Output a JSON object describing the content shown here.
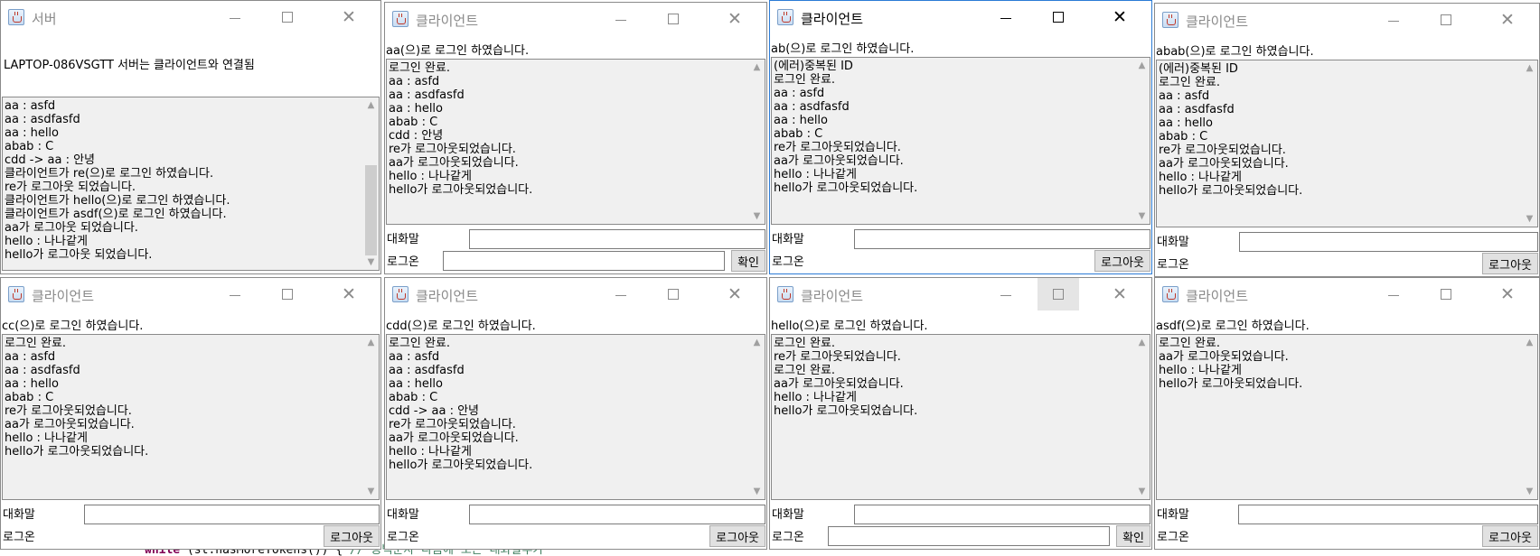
{
  "labels": {
    "chat": "대화말",
    "login": "로그온",
    "confirm": "확인",
    "logout": "로그아웃"
  },
  "server": {
    "title": "서버",
    "status": "LAPTOP-086VSGTT 서버는 클라이언트와 연결됨",
    "lines": [
      "aa : asfd",
      "aa : asdfasfd",
      "aa : hello",
      "abab : C",
      "cdd -> aa : 안녕",
      "클라이언트가 re(으)로 로그인 하였습니다.",
      "re가 로그아웃 되었습니다.",
      "클라이언트가 hello(으)로 로그인 하였습니다.",
      "클라이언트가 asdf(으)로 로그인 하였습니다.",
      "aa가 로그아웃 되었습니다.",
      "hello : 나나같게",
      "hello가 로그아웃 되었습니다."
    ]
  },
  "clients": [
    {
      "title": "클라이언트",
      "status": "aa(으)로 로그인 하였습니다.",
      "action": "확인",
      "lines": [
        "로그인 완료.",
        "aa : asfd",
        "aa : asdfasfd",
        "aa : hello",
        "abab : C",
        "cdd : 안녕",
        "re가 로그아웃되었습니다.",
        "aa가 로그아웃되었습니다.",
        "hello : 나나같게",
        "hello가 로그아웃되었습니다."
      ]
    },
    {
      "title": "클라이언트",
      "status": "ab(으)로 로그인 하였습니다.",
      "action": "로그아웃",
      "lines": [
        "(에러)중복된 ID",
        "로그인 완료.",
        "aa : asfd",
        "aa : asdfasfd",
        "aa : hello",
        "abab : C",
        "re가 로그아웃되었습니다.",
        "aa가 로그아웃되었습니다.",
        "hello : 나나같게",
        "hello가 로그아웃되었습니다."
      ]
    },
    {
      "title": "클라이언트",
      "status": "abab(으)로 로그인 하였습니다.",
      "action": "로그아웃",
      "lines": [
        "(에러)중복된 ID",
        "로그인 완료.",
        "aa : asfd",
        "aa : asdfasfd",
        "aa : hello",
        "abab : C",
        "re가 로그아웃되었습니다.",
        "aa가 로그아웃되었습니다.",
        "hello : 나나같게",
        "hello가 로그아웃되었습니다."
      ]
    },
    {
      "title": "클라이언트",
      "status": "cc(으)로 로그인 하였습니다.",
      "action": "로그아웃",
      "lines": [
        "로그인 완료.",
        "aa : asfd",
        "aa : asdfasfd",
        "aa : hello",
        "abab : C",
        "re가 로그아웃되었습니다.",
        "aa가 로그아웃되었습니다.",
        "hello : 나나같게",
        "hello가 로그아웃되었습니다."
      ]
    },
    {
      "title": "클라이언트",
      "status": "cdd(으)로 로그인 하였습니다.",
      "action": "로그아웃",
      "lines": [
        "로그인 완료.",
        "aa : asfd",
        "aa : asdfasfd",
        "aa : hello",
        "abab : C",
        "cdd -> aa : 안녕",
        "re가 로그아웃되었습니다.",
        "aa가 로그아웃되었습니다.",
        "hello : 나나같게",
        "hello가 로그아웃되었습니다."
      ]
    },
    {
      "title": "클라이언트",
      "status": "hello(으)로 로그인 하였습니다.",
      "action": "확인",
      "lines": [
        "로그인 완료.",
        "re가 로그아웃되었습니다.",
        "로그인 완료.",
        "aa가 로그아웃되었습니다.",
        "hello : 나나같게",
        "hello가 로그아웃되었습니다."
      ]
    },
    {
      "title": "클라이언트",
      "status": "asdf(으)로 로그인 하였습니다.",
      "action": "로그아웃",
      "lines": [
        "로그인 완료.",
        "aa가 로그아웃되었습니다.",
        "hello : 나나같게",
        "hello가 로그아웃되었습니다."
      ]
    }
  ],
  "code_behind": {
    "keyword": "while",
    "code": " (st.hasMoreTokens()) { ",
    "comment": "// 공백문자 다음에 오는 대화말추가"
  }
}
